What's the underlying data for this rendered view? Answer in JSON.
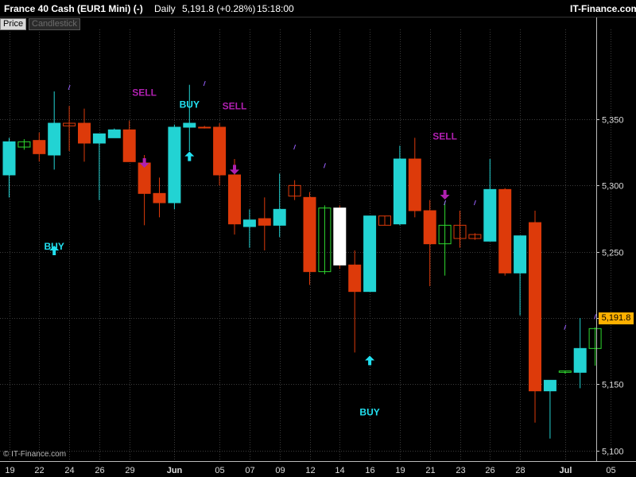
{
  "header": {
    "instrument": "France 40 Cash (EUR1 Mini) (-)",
    "period": "Daily",
    "last": "5,191.8 (+0.28%)",
    "time": "15:18:00",
    "brand": "IT-Finance.com"
  },
  "tabs": {
    "price": "Price",
    "type": "Candlestick"
  },
  "footer": "© IT-Finance.com",
  "last_price_label": "5,191.8",
  "colors": {
    "up": "#22d3d3",
    "down": "#dd3a0a",
    "buy": "#22e0f0",
    "sell": "#b020b0",
    "tick": "#9a60ff"
  },
  "chart_data": {
    "type": "candlestick",
    "ylim": [
      5098,
      5380
    ],
    "y_ticks": [
      5100,
      5150,
      5200,
      5250,
      5300,
      5350
    ],
    "y_tick_labels": [
      "5,100",
      "5,150",
      "5,200",
      "5,250",
      "5,300",
      "5,350"
    ],
    "x_ticks": [
      {
        "i": 0,
        "label": "19"
      },
      {
        "i": 2,
        "label": "22"
      },
      {
        "i": 4,
        "label": "24"
      },
      {
        "i": 6,
        "label": "26"
      },
      {
        "i": 8,
        "label": "29"
      },
      {
        "i": 11,
        "label": "Jun"
      },
      {
        "i": 14,
        "label": "05"
      },
      {
        "i": 16,
        "label": "07"
      },
      {
        "i": 18,
        "label": "09"
      },
      {
        "i": 20,
        "label": "12"
      },
      {
        "i": 22,
        "label": "14"
      },
      {
        "i": 24,
        "label": "16"
      },
      {
        "i": 26,
        "label": "19"
      },
      {
        "i": 28,
        "label": "21"
      },
      {
        "i": 30,
        "label": "23"
      },
      {
        "i": 32,
        "label": "26"
      },
      {
        "i": 34,
        "label": "28"
      },
      {
        "i": 37,
        "label": "Jul"
      },
      {
        "i": 40,
        "label": "05"
      }
    ],
    "candles": [
      {
        "o": 5308,
        "h": 5336,
        "l": 5291,
        "c": 5333,
        "s": "fill"
      },
      {
        "o": 5329,
        "h": 5335,
        "l": 5327,
        "c": 5333,
        "s": "hollow-green"
      },
      {
        "o": 5334,
        "h": 5340,
        "l": 5318,
        "c": 5324,
        "s": "fill"
      },
      {
        "o": 5323,
        "h": 5371,
        "l": 5312,
        "c": 5347,
        "s": "fill"
      },
      {
        "o": 5347,
        "h": 5360,
        "l": 5326,
        "c": 5345,
        "s": "hollow-red"
      },
      {
        "o": 5347,
        "h": 5358,
        "l": 5318,
        "c": 5332,
        "s": "fill"
      },
      {
        "o": 5332,
        "h": 5338,
        "l": 5289,
        "c": 5339,
        "s": "fill"
      },
      {
        "o": 5336,
        "h": 5343,
        "l": 5336,
        "c": 5342,
        "s": "fill"
      },
      {
        "o": 5342,
        "h": 5349,
        "l": 5318,
        "c": 5318,
        "s": "fill"
      },
      {
        "o": 5317,
        "h": 5323,
        "l": 5270,
        "c": 5294,
        "s": "fill"
      },
      {
        "o": 5294,
        "h": 5306,
        "l": 5276,
        "c": 5287,
        "s": "fill"
      },
      {
        "o": 5287,
        "h": 5346,
        "l": 5282,
        "c": 5344,
        "s": "fill"
      },
      {
        "o": 5344,
        "h": 5376,
        "l": 5326,
        "c": 5347,
        "s": "fill"
      },
      {
        "o": 5344,
        "h": 5345,
        "l": 5343,
        "c": 5344,
        "s": "hollow-red"
      },
      {
        "o": 5344,
        "h": 5347,
        "l": 5300,
        "c": 5308,
        "s": "fill"
      },
      {
        "o": 5308,
        "h": 5320,
        "l": 5263,
        "c": 5271,
        "s": "fill"
      },
      {
        "o": 5269,
        "h": 5282,
        "l": 5253,
        "c": 5274,
        "s": "fill"
      },
      {
        "o": 5275,
        "h": 5291,
        "l": 5251,
        "c": 5270,
        "s": "fill"
      },
      {
        "o": 5270,
        "h": 5309,
        "l": 5261,
        "c": 5282,
        "s": "fill"
      },
      {
        "o": 5292,
        "h": 5304,
        "l": 5289,
        "c": 5300,
        "s": "hollow-red"
      },
      {
        "o": 5291,
        "h": 5295,
        "l": 5225,
        "c": 5235,
        "s": "fill"
      },
      {
        "o": 5235,
        "h": 5285,
        "l": 5233,
        "c": 5283,
        "s": "hollow-green"
      },
      {
        "o": 5283,
        "h": 5285,
        "l": 5237,
        "c": 5240,
        "s": "white"
      },
      {
        "o": 5240,
        "h": 5251,
        "l": 5174,
        "c": 5220,
        "s": "fill"
      },
      {
        "o": 5220,
        "h": 5277,
        "l": 5220,
        "c": 5277,
        "s": "fill"
      },
      {
        "o": 5277,
        "h": 5277,
        "l": 5270,
        "c": 5270,
        "s": "hollow-red"
      },
      {
        "o": 5271,
        "h": 5330,
        "l": 5270,
        "c": 5320,
        "s": "fill"
      },
      {
        "o": 5320,
        "h": 5336,
        "l": 5276,
        "c": 5281,
        "s": "fill"
      },
      {
        "o": 5281,
        "h": 5289,
        "l": 5224,
        "c": 5256,
        "s": "fill"
      },
      {
        "o": 5256,
        "h": 5288,
        "l": 5232,
        "c": 5270,
        "s": "hollow-green"
      },
      {
        "o": 5270,
        "h": 5281,
        "l": 5253,
        "c": 5260,
        "s": "hollow-red"
      },
      {
        "o": 5263,
        "h": 5264,
        "l": 5259,
        "c": 5260,
        "s": "hollow-red"
      },
      {
        "o": 5258,
        "h": 5320,
        "l": 5258,
        "c": 5297,
        "s": "fill"
      },
      {
        "o": 5297,
        "h": 5298,
        "l": 5232,
        "c": 5234,
        "s": "fill"
      },
      {
        "o": 5234,
        "h": 5262,
        "l": 5202,
        "c": 5262,
        "s": "fill"
      },
      {
        "o": 5272,
        "h": 5281,
        "l": 5121,
        "c": 5145,
        "s": "fill"
      },
      {
        "o": 5145,
        "h": 5153,
        "l": 5109,
        "c": 5153,
        "s": "fill"
      },
      {
        "o": 5159,
        "h": 5160,
        "l": 5158,
        "c": 5160,
        "s": "hollow-green"
      },
      {
        "o": 5159,
        "h": 5200,
        "l": 5147,
        "c": 5177,
        "s": "fill"
      },
      {
        "o": 5177,
        "h": 5193,
        "l": 5164,
        "c": 5192,
        "s": "hollow-green"
      }
    ],
    "signals": [
      {
        "label": "BUY",
        "i": 3,
        "arrow": "up",
        "arrow_y": 5251,
        "text_y": 5254
      },
      {
        "label": "SELL",
        "i": 9,
        "arrow": "down",
        "arrow_y": 5317,
        "text_y": 5370
      },
      {
        "label": "BUY",
        "i": 12,
        "arrow": "up",
        "arrow_y": 5322,
        "text_y": 5361
      },
      {
        "label": "SELL",
        "i": 15,
        "arrow": "down",
        "arrow_y": 5312,
        "text_y": 5360
      },
      {
        "label": "BUY",
        "i": 24,
        "arrow": "up",
        "arrow_y": 5168,
        "text_y": 5129
      },
      {
        "label": "SELL",
        "i": 29,
        "arrow": "down",
        "arrow_y": 5293,
        "text_y": 5337
      }
    ],
    "ticks_marks": [
      {
        "i": 4,
        "y": 5374
      },
      {
        "i": 13,
        "y": 5377
      },
      {
        "i": 19,
        "y": 5329
      },
      {
        "i": 21,
        "y": 5315
      },
      {
        "i": 29,
        "y": 5287
      },
      {
        "i": 31,
        "y": 5287
      },
      {
        "i": 37,
        "y": 5193
      },
      {
        "i": 39,
        "y": 5201
      }
    ]
  }
}
